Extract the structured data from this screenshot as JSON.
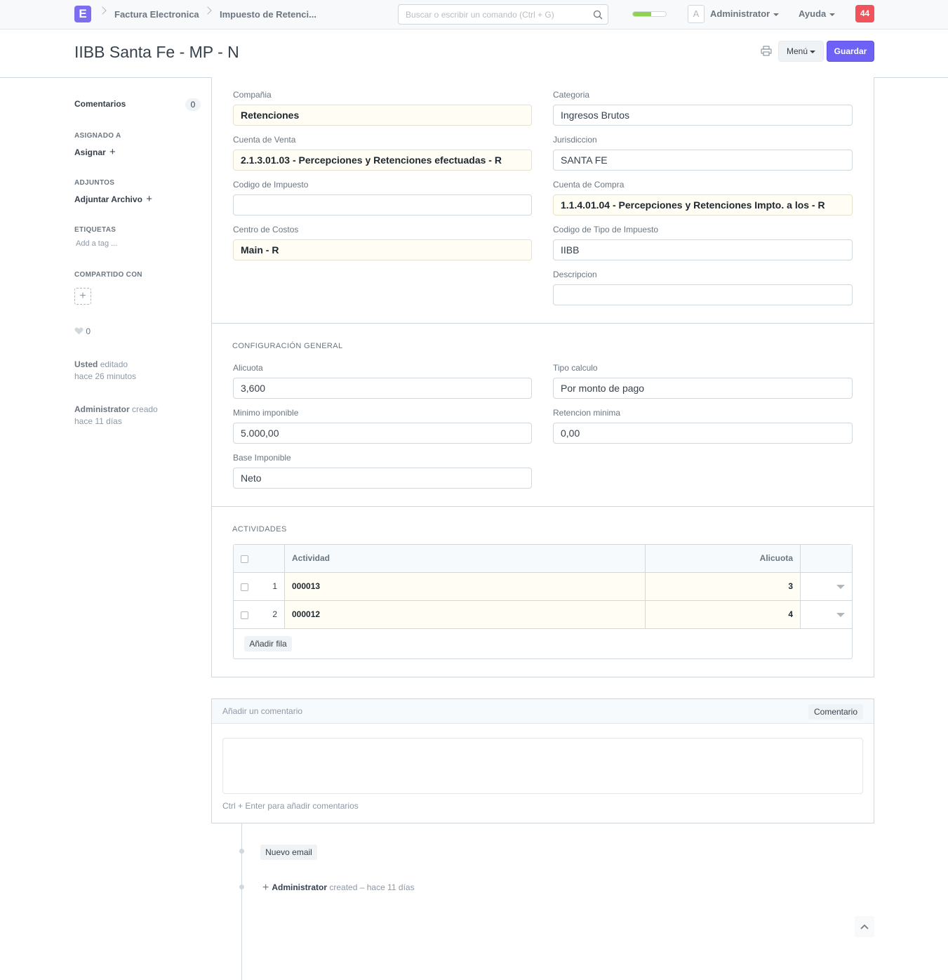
{
  "navbar": {
    "logo": "E",
    "breadcrumbs": [
      "Factura Electronica",
      "Impuesto de Retenci..."
    ],
    "search_placeholder": "Buscar o escribir un comando (Ctrl + G)",
    "progress": 0.55,
    "avatar_letter": "A",
    "user_label": "Administrator",
    "help_label": "Ayuda",
    "notifications": "44"
  },
  "page": {
    "title": "IIBB Santa Fe - MP - N",
    "menu_label": "Menú",
    "save_label": "Guardar"
  },
  "sidebar": {
    "comments_label": "Comentarios",
    "comments_count": "0",
    "assigned_heading": "ASIGNADO A",
    "assign_label": "Asignar",
    "attachments_heading": "ADJUNTOS",
    "attach_label": "Adjuntar Archivo",
    "tags_heading": "ETIQUETAS",
    "add_tag": "Add a tag ...",
    "shared_heading": "COMPARTIDO CON",
    "likes": "0",
    "edit_user": "Usted",
    "edit_action": "editado",
    "edit_time": "hace 26 minutos",
    "create_user": "Administrator",
    "create_action": "creado",
    "create_time": "hace 11 días"
  },
  "form": {
    "compania_label": "Compañia",
    "compania_value": "Retenciones",
    "categoria_label": "Categoria",
    "categoria_value": "Ingresos Brutos",
    "cuenta_venta_label": "Cuenta de Venta",
    "cuenta_venta_value": "2.1.3.01.03 - Percepciones y Retenciones efectuadas - R",
    "jurisdiccion_label": "Jurisdiccion",
    "jurisdiccion_value": "SANTA FE",
    "codigo_impuesto_label": "Codigo de Impuesto",
    "codigo_impuesto_value": "",
    "cuenta_compra_label": "Cuenta de Compra",
    "cuenta_compra_value": "1.1.4.01.04 - Percepciones y Retenciones Impto. a los - R",
    "centro_costos_label": "Centro de Costos",
    "centro_costos_value": "Main - R",
    "codigo_tipo_label": "Codigo de Tipo de Impuesto",
    "codigo_tipo_value": "IIBB",
    "descripcion_label": "Descripcion",
    "descripcion_value": ""
  },
  "config": {
    "section_title": "CONFIGURACIÓN GENERAL",
    "alicuota_label": "Alicuota",
    "alicuota_value": "3,600",
    "tipo_calculo_label": "Tipo calculo",
    "tipo_calculo_value": "Por monto de pago",
    "minimo_label": "Minimo imponible",
    "minimo_value": "5.000,00",
    "retencion_label": "Retencion minima",
    "retencion_value": "0,00",
    "base_label": "Base Imponible",
    "base_value": "Neto"
  },
  "activities": {
    "section_title": "ACTIVIDADES",
    "columns": [
      "Actividad",
      "Alicuota"
    ],
    "rows": [
      {
        "idx": "1",
        "actividad": "000013",
        "alicuota": "3"
      },
      {
        "idx": "2",
        "actividad": "000012",
        "alicuota": "4"
      }
    ],
    "add_row_label": "Añadir fila"
  },
  "comments": {
    "placeholder": "Añadir un comentario",
    "button_label": "Comentario",
    "hint": "Ctrl + Enter para añadir comentarios"
  },
  "timeline": {
    "new_email_label": "Nuevo email",
    "entry_user": "Administrator",
    "entry_text": "created – hace 11 días"
  }
}
